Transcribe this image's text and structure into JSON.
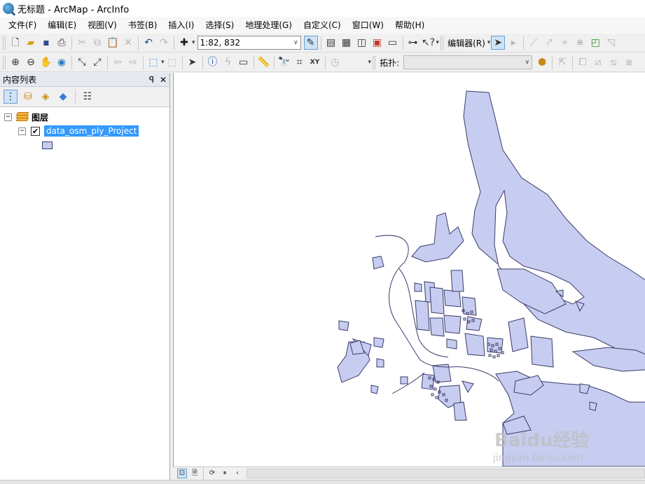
{
  "window": {
    "title": "无标题 - ArcMap - ArcInfo"
  },
  "menu": [
    "文件(F)",
    "编辑(E)",
    "视图(V)",
    "书签(B)",
    "插入(I)",
    "选择(S)",
    "地理处理(G)",
    "自定义(C)",
    "窗口(W)",
    "帮助(H)"
  ],
  "toolbar": {
    "scale_value": "1:82, 832",
    "editor_label": "编辑器(R)",
    "topology_label": "拓扑:"
  },
  "toc": {
    "title": "内容列表",
    "pin": "ꟼ",
    "close": "✕",
    "group_label": "图层",
    "layer_label": "data_osm_ply_Project",
    "layer_checked": true,
    "fill_color": "#c6cdf1",
    "outline_color": "#3b3b6a"
  },
  "watermark": {
    "brand": "Baidu经验",
    "url": "jingyan.baidu.com"
  },
  "icons": [
    "new-icon",
    "open-icon",
    "save-icon",
    "print-icon",
    "cut-icon",
    "copy-icon",
    "paste-icon",
    "delete-icon",
    "undo-icon",
    "redo-icon",
    "add-data-icon",
    "zoom-in-icon",
    "zoom-out-icon",
    "pan-icon",
    "globe-icon",
    "select-icon",
    "identify-icon",
    "find-icon",
    "goto-xy-icon"
  ]
}
